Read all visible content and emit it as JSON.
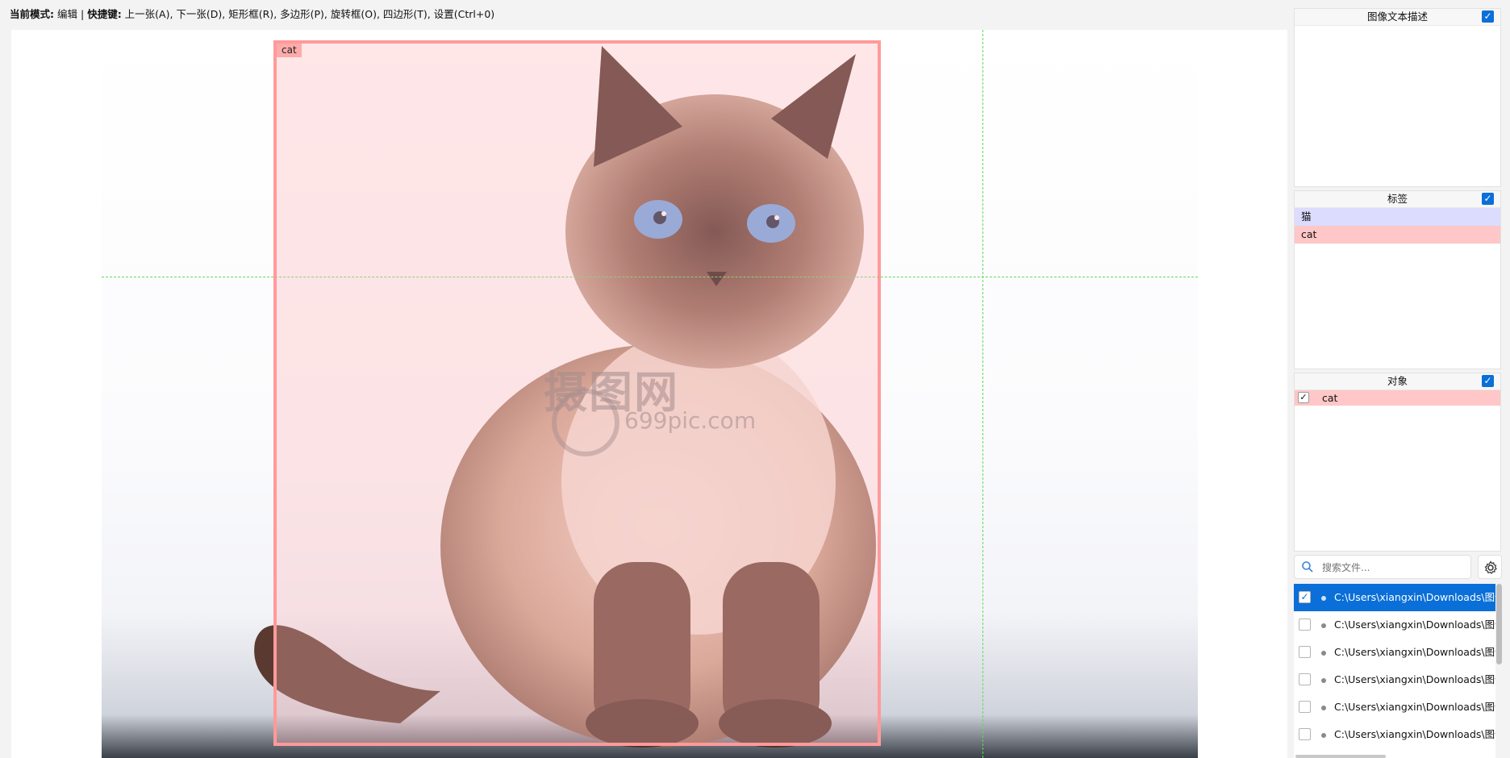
{
  "topbar": {
    "mode_label": "当前模式:",
    "mode_value": "编辑",
    "sep": "|",
    "shortcut_label": "快捷键:",
    "shortcuts": "上一张(A), 下一张(D), 矩形框(R), 多边形(P), 旋转框(O), 四边形(T), 设置(Ctrl+0)"
  },
  "canvas": {
    "bbox_label": "cat",
    "watermark_main": "摄图网",
    "watermark_sub": "699pic.com"
  },
  "panels": {
    "description": {
      "title": "图像文本描述",
      "checked": true
    },
    "labels": {
      "title": "标签",
      "checked": true,
      "items": [
        {
          "text": "猫",
          "color": "#dcdcff"
        },
        {
          "text": "cat",
          "color": "#ffc7c7"
        }
      ]
    },
    "objects": {
      "title": "对象",
      "checked": true,
      "items": [
        {
          "text": "cat",
          "checked": true
        }
      ]
    }
  },
  "search": {
    "placeholder": "搜索文件..."
  },
  "files": [
    {
      "path": "C:\\Users\\xiangxin\\Downloads\\图像",
      "checked": true,
      "selected": true
    },
    {
      "path": "C:\\Users\\xiangxin\\Downloads\\图像",
      "checked": false,
      "selected": false
    },
    {
      "path": "C:\\Users\\xiangxin\\Downloads\\图像",
      "checked": false,
      "selected": false
    },
    {
      "path": "C:\\Users\\xiangxin\\Downloads\\图像",
      "checked": false,
      "selected": false
    },
    {
      "path": "C:\\Users\\xiangxin\\Downloads\\图像",
      "checked": false,
      "selected": false
    },
    {
      "path": "C:\\Users\\xiangxin\\Downloads\\图像",
      "checked": false,
      "selected": false
    }
  ],
  "colors": {
    "accent": "#0a6fd8",
    "bbox": "#ff9a9a",
    "crosshair": "#5fdc5f"
  }
}
